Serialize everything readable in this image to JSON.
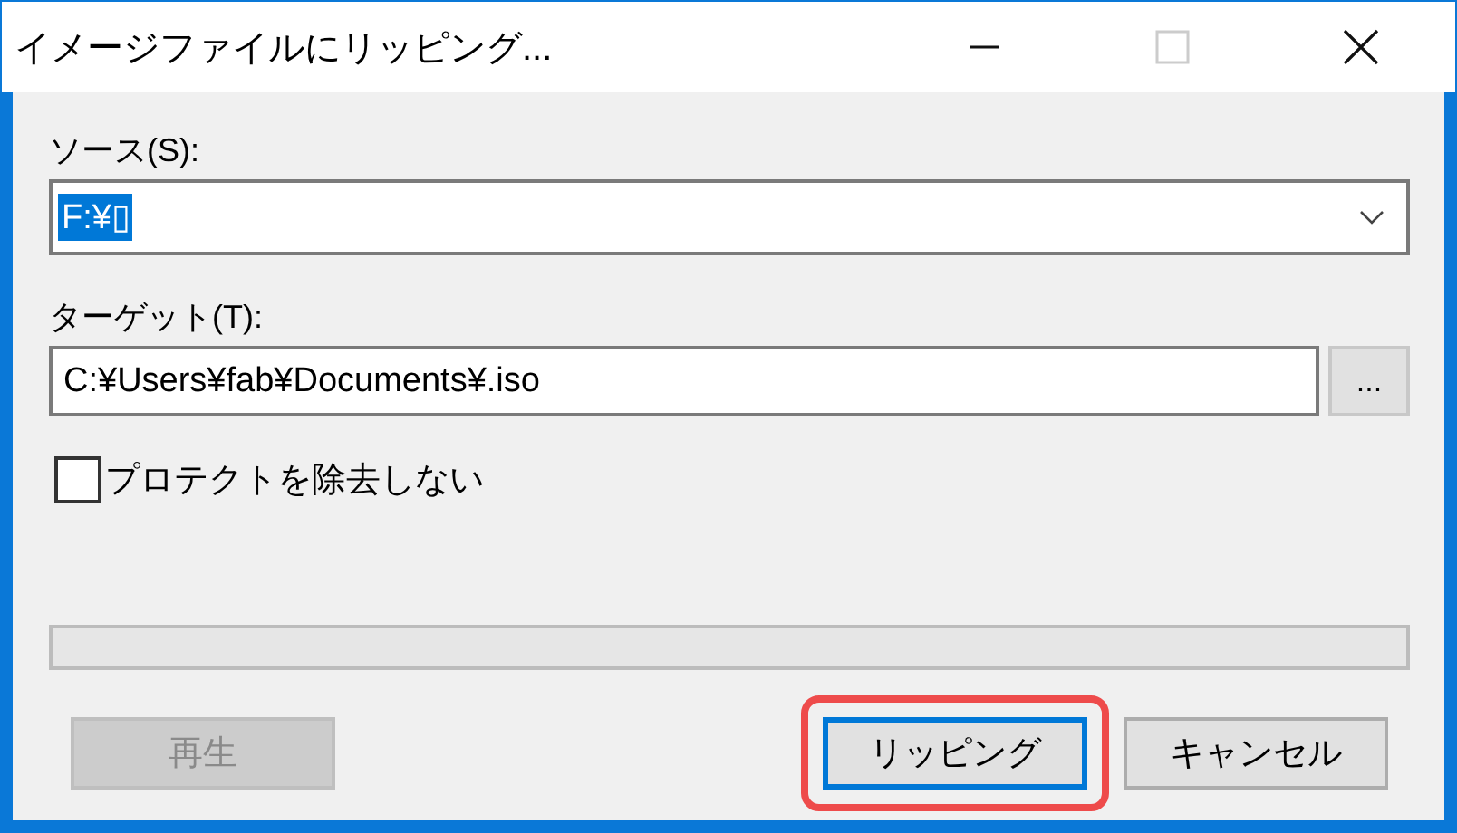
{
  "window": {
    "title": "イメージファイルにリッピング...",
    "maximize_disabled": true
  },
  "source": {
    "label": "ソース(S):",
    "value": "F:¥▯",
    "selected": true
  },
  "target": {
    "label": "ターゲット(T):",
    "value": "C:¥Users¥fab¥Documents¥.iso",
    "browse": "..."
  },
  "checkbox": {
    "label": "プロテクトを除去しない",
    "checked": false
  },
  "progress": {
    "level": 0
  },
  "buttons": [
    {
      "label": "再生",
      "disabled": true,
      "default": false,
      "highlighted": false
    },
    {
      "label": "リッピング",
      "disabled": false,
      "default": true,
      "highlighted": true
    },
    {
      "label": "キャンセル",
      "disabled": false,
      "default": false,
      "highlighted": false
    }
  ]
}
